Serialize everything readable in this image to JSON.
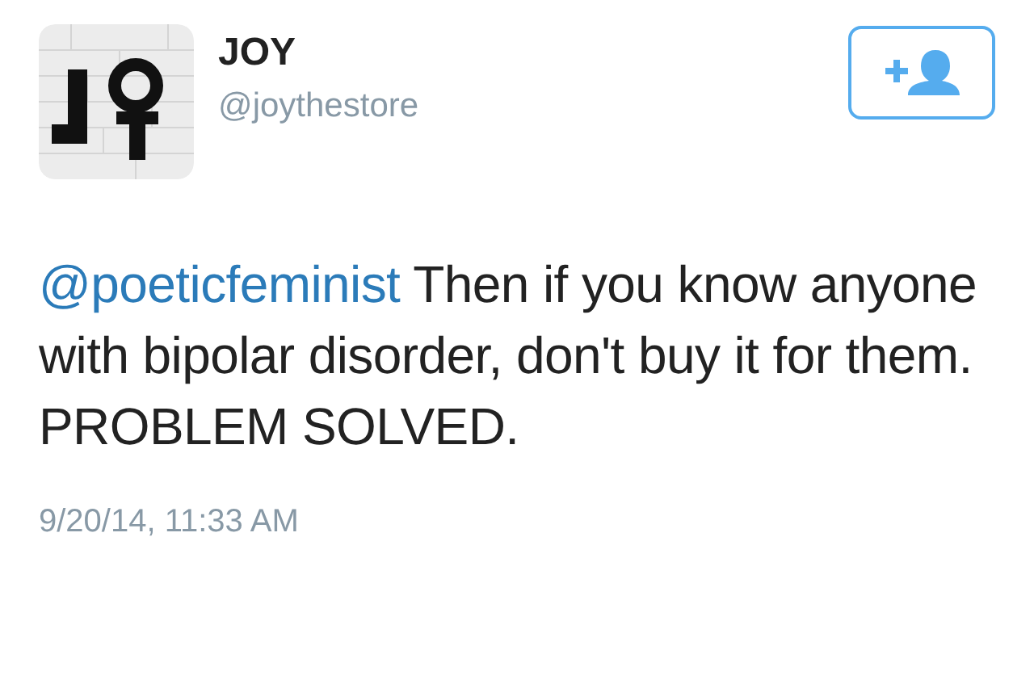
{
  "user": {
    "name": "JOY",
    "handle": "@joythestore"
  },
  "tweet": {
    "mention": "@poeticfeminist",
    "text": "Then if you know anyone with bipolar disorder, don't buy it for them. PROBLEM SOLVED."
  },
  "timestamp": "9/20/14, 11:33 AM"
}
